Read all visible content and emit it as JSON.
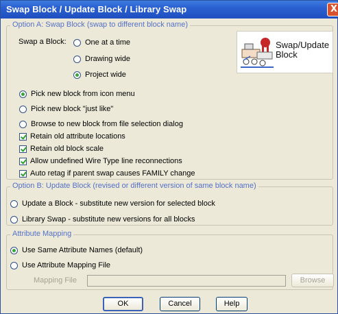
{
  "window": {
    "title": "Swap Block / Update Block / Library Swap"
  },
  "titlebar": {
    "close_glyph": "X",
    "close_icon": "close-icon"
  },
  "option_a": {
    "legend": "Option A: Swap Block (swap to different block name)",
    "swap_label": "Swap a Block:",
    "scope": [
      {
        "label": "One at a time",
        "selected": false
      },
      {
        "label": "Drawing wide",
        "selected": false
      },
      {
        "label": "Project wide",
        "selected": true
      }
    ],
    "icon_label_line1": "Swap/Update",
    "icon_label_line2": "Block",
    "icon_name": "swap-block-icon",
    "pick_options": [
      {
        "label": "Pick new block from icon menu",
        "selected": true
      },
      {
        "label": "Pick new block \"just like\"",
        "selected": false
      },
      {
        "label": "Browse to new block from file selection dialog",
        "selected": false
      }
    ],
    "checkboxes": [
      {
        "label": "Retain old attribute locations",
        "checked": true
      },
      {
        "label": "Retain old block scale",
        "checked": true
      },
      {
        "label": "Allow undefined Wire Type line reconnections",
        "checked": true
      },
      {
        "label": "Auto retag if parent swap causes FAMILY change",
        "checked": true
      }
    ]
  },
  "option_b": {
    "legend": "Option B: Update Block (revised or different version of same block name)",
    "options": [
      {
        "label": "Update a Block - substitute new version for selected block",
        "selected": false
      },
      {
        "label": "Library Swap - substitute new versions for all blocks",
        "selected": false
      }
    ]
  },
  "attribute_mapping": {
    "legend": "Attribute Mapping",
    "options": [
      {
        "label": "Use Same Attribute Names (default)",
        "selected": true
      },
      {
        "label": "Use Attribute Mapping File",
        "selected": false
      }
    ],
    "mapping_file_label": "Mapping File",
    "mapping_file_value": "",
    "browse_label": "Browse"
  },
  "buttons": {
    "ok": "OK",
    "cancel": "Cancel",
    "help": "Help"
  },
  "colors": {
    "titlebar": "#2a5fd0",
    "legend_text": "#5470c8",
    "window_bg": "#ece9d8",
    "close": "#d7532f",
    "radio_dot": "#3ba43b"
  }
}
